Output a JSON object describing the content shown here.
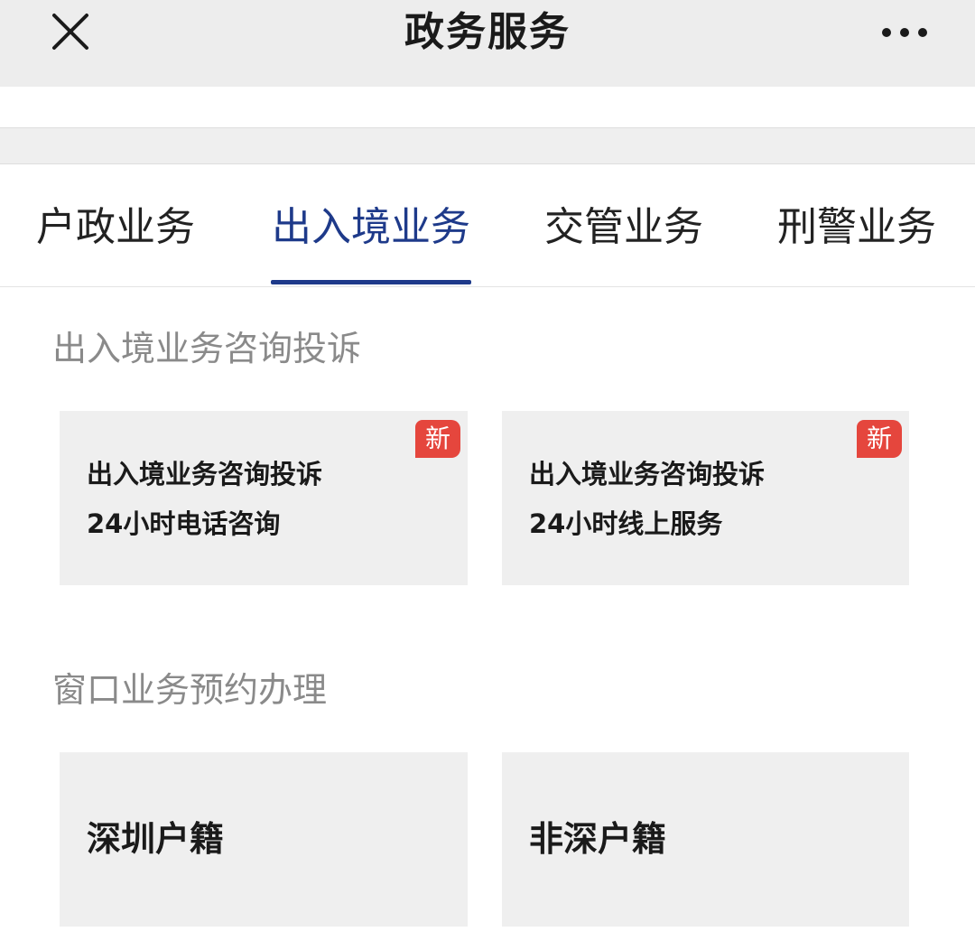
{
  "header": {
    "title": "政务服务",
    "close_icon": "close-icon",
    "more_icon": "more-icon"
  },
  "tabs": [
    {
      "label": "户政业务",
      "active": false
    },
    {
      "label": "出入境业务",
      "active": true
    },
    {
      "label": "交管业务",
      "active": false
    },
    {
      "label": "刑警业务",
      "active": false
    }
  ],
  "sections": [
    {
      "title": "出入境业务咨询投诉",
      "cards": [
        {
          "line1": "出入境业务咨询投诉",
          "line2": "24小时电话咨询",
          "badge": "新"
        },
        {
          "line1": "出入境业务咨询投诉",
          "line2": "24小时线上服务",
          "badge": "新"
        }
      ]
    },
    {
      "title": "窗口业务预约办理",
      "cards": [
        {
          "label": "深圳户籍"
        },
        {
          "label": "非深户籍"
        }
      ]
    }
  ],
  "colors": {
    "accent": "#1e3a8a",
    "badge": "#e5463d",
    "card_bg": "#efefef",
    "topbar_bg": "#ededed"
  }
}
